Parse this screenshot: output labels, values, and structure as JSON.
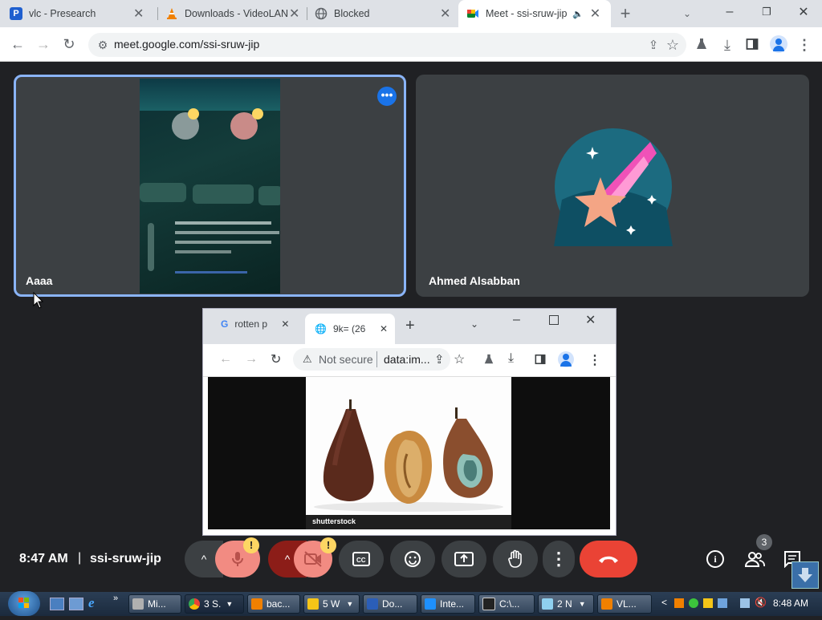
{
  "browser": {
    "tabs": [
      {
        "label": "vlc - Presearch",
        "icon": "presearch-icon"
      },
      {
        "label": "Downloads - VideoLAN",
        "icon": "vlc-cone-icon"
      },
      {
        "label": "Blocked",
        "icon": "globe-icon"
      },
      {
        "label": "Meet - ssi-sruw-jip",
        "icon": "meet-icon"
      }
    ],
    "url": "meet.google.com/ssi-sruw-jip"
  },
  "meet": {
    "participants": [
      {
        "name": "Aaaa"
      },
      {
        "name": "Ahmed Alsabban"
      }
    ],
    "time": "8:47 AM",
    "separator": "|",
    "meeting_code": "ssi-sruw-jip",
    "people_count": "3",
    "warning_badge": "!"
  },
  "shared_window": {
    "tabs": [
      {
        "label": "rotten p"
      },
      {
        "label": "9k= (26"
      }
    ],
    "security_label": "Not secure",
    "url": "data:im...",
    "image_watermark": "shutterstock"
  },
  "taskbar": {
    "items": [
      {
        "label": "Mi..."
      },
      {
        "label": "3 S."
      },
      {
        "label": "bac..."
      },
      {
        "label": "5 W"
      },
      {
        "label": "Do..."
      },
      {
        "label": "Inte..."
      },
      {
        "label": "C:\\..."
      },
      {
        "label": "2 N"
      },
      {
        "label": "VL..."
      }
    ],
    "clock": "8:48 AM"
  },
  "colors": {
    "meet_background": "#202124",
    "tile": "#3c4043",
    "active_tile_border": "#8ab4f8",
    "end_call": "#ea4335",
    "muted_control": "#f28b82",
    "warning": "#fdd663"
  }
}
